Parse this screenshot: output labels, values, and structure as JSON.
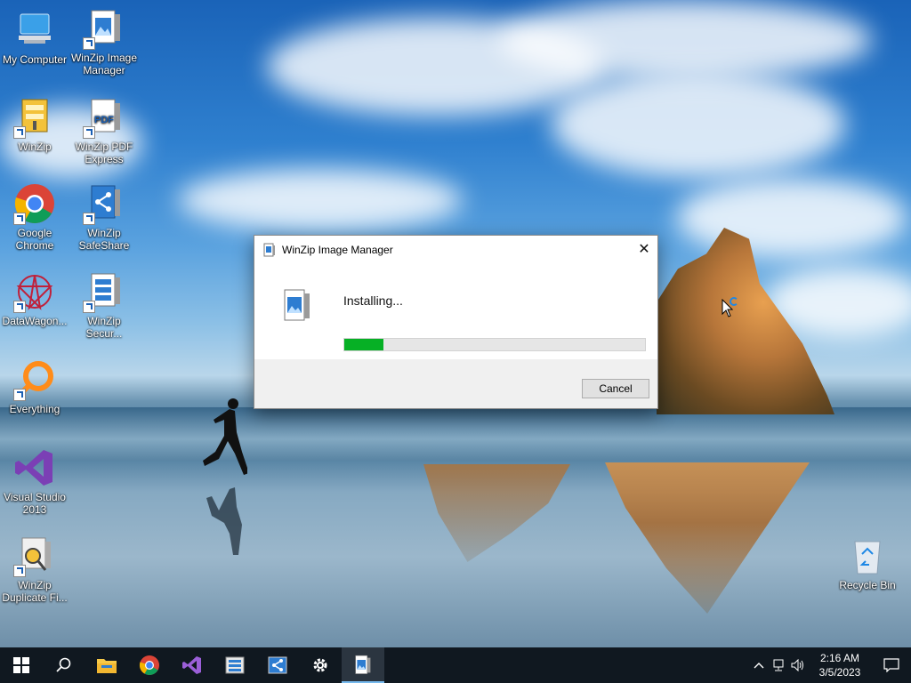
{
  "desktop": {
    "icons": [
      {
        "label": "My Computer",
        "icon": "computer-icon"
      },
      {
        "label": "WinZip Image Manager",
        "icon": "winzip-image-manager-icon"
      },
      {
        "label": "WinZip",
        "icon": "winzip-icon"
      },
      {
        "label": "WinZip PDF Express",
        "icon": "winzip-pdf-icon"
      },
      {
        "label": "Google Chrome",
        "icon": "chrome-icon"
      },
      {
        "label": "WinZip SafeShare",
        "icon": "winzip-safeshare-icon"
      },
      {
        "label": "DataWagon...",
        "icon": "datawagon-icon"
      },
      {
        "label": "WinZip Secur...",
        "icon": "winzip-secure-icon"
      },
      {
        "label": "Everything",
        "icon": "everything-icon"
      },
      {
        "label": "Visual Studio 2013",
        "icon": "visual-studio-icon"
      },
      {
        "label": "WinZip Duplicate Fi...",
        "icon": "winzip-duplicate-icon"
      },
      {
        "label": "Recycle Bin",
        "icon": "recycle-bin-icon"
      }
    ]
  },
  "dialog": {
    "title": "WinZip Image Manager",
    "status": "Installing...",
    "progress": 0.13,
    "cancel_label": "Cancel",
    "close_glyph": "✕"
  },
  "taskbar": {
    "items": [
      "start",
      "search",
      "file-explorer",
      "chrome",
      "visual-studio",
      "winzip-secure",
      "winzip-safeshare",
      "settings",
      "winzip-image-manager"
    ],
    "time": "2:16 AM",
    "date": "3/5/2023"
  },
  "colors": {
    "progress_fill": "#06b025",
    "taskbar": "#101820",
    "accent": "#76b9ed"
  }
}
